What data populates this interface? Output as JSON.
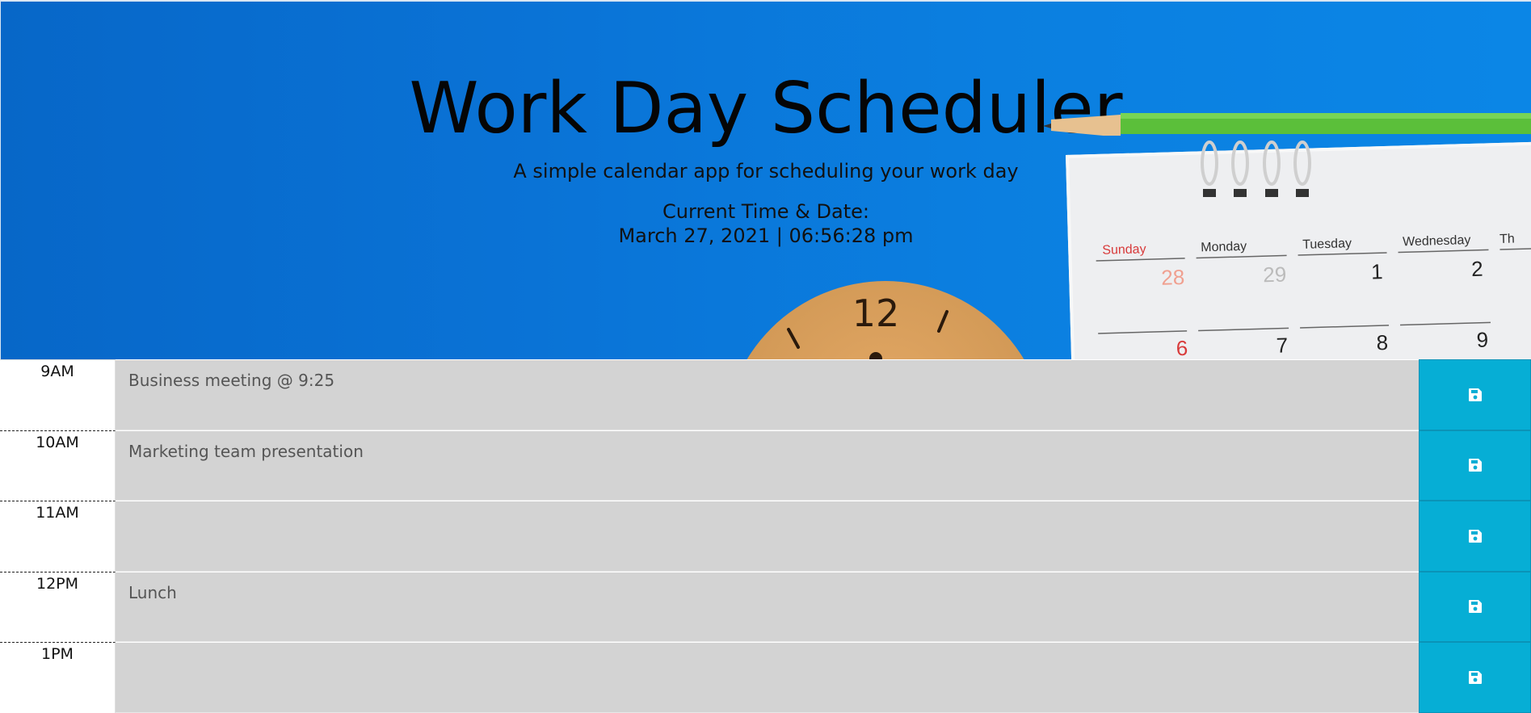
{
  "header": {
    "title": "Work Day Scheduler",
    "subtitle": "A simple calendar app for scheduling your work day",
    "time_label": "Current Time & Date:",
    "time_value": "March 27, 2021 | 06:56:28 pm"
  },
  "hero_image": {
    "clock_numeral": "12",
    "calendar_days": [
      "Sunday",
      "Monday",
      "Tuesday",
      "Wednesday",
      "Th"
    ],
    "calendar_dates_row1": [
      "28",
      "29",
      "1",
      "2"
    ],
    "calendar_dates_row2": [
      "6",
      "7",
      "8",
      "9"
    ]
  },
  "schedule": {
    "rows": [
      {
        "hour": "9AM",
        "event": "Business meeting @ 9:25"
      },
      {
        "hour": "10AM",
        "event": "Marketing team presentation"
      },
      {
        "hour": "11AM",
        "event": ""
      },
      {
        "hour": "12PM",
        "event": "Lunch"
      },
      {
        "hour": "1PM",
        "event": ""
      }
    ],
    "save_icon": "floppy-disk-icon"
  },
  "colors": {
    "hero_blue": "#0a73d6",
    "event_bg": "#d3d3d3",
    "save_button": "#06aed5"
  }
}
